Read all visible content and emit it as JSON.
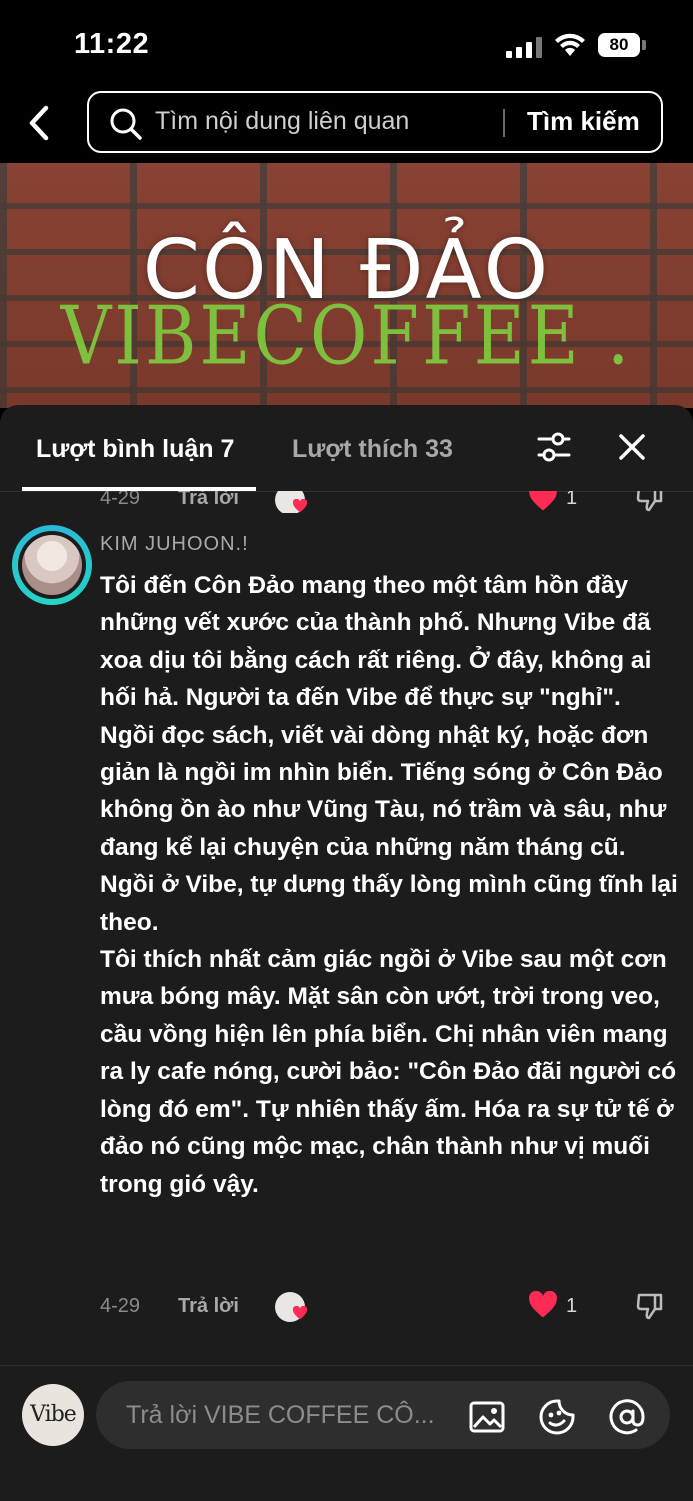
{
  "status_bar": {
    "time": "11:22",
    "battery": "80"
  },
  "search": {
    "placeholder": "Tìm nội dung liên quan",
    "button_label": "Tìm kiếm"
  },
  "banner": {
    "title": "CÔN ĐẢO",
    "subtitle": "VIBECOFFEE ."
  },
  "tabs": [
    {
      "label": "Lượt bình luận 7",
      "active": true
    },
    {
      "label": "Lượt thích 33",
      "active": false
    }
  ],
  "previous_comment": {
    "date": "4-29",
    "reply_label": "Trả lời",
    "likes": "1"
  },
  "comment": {
    "username": "KIM JUHOON.!",
    "paragraphs": [
      "Tôi đến Côn Đảo mang theo một tâm hồn đầy những vết xước của thành phố. Nhưng Vibe đã xoa dịu tôi bằng cách rất riêng. Ở đây, không ai hối hả. Người ta đến Vibe để thực sự \"nghỉ\". Ngồi đọc sách, viết vài dòng nhật ký, hoặc đơn giản là ngồi im nhìn biển. Tiếng sóng ở Côn Đảo không ồn ào như Vũng Tàu, nó trầm và sâu, như đang kể lại chuyện của những năm tháng cũ. Ngồi ở Vibe, tự dưng thấy lòng mình cũng tĩnh lại theo.",
      "Tôi thích nhất cảm giác ngồi ở Vibe sau một cơn mưa bóng mây. Mặt sân còn ướt, trời trong veo, cầu vồng hiện lên phía biển. Chị nhân viên mang ra ly cafe nóng, cười bảo: \"Côn Đảo đãi người có lòng đó em\". Tự nhiên thấy ấm. Hóa ra sự tử tế ở đảo nó cũng mộc mạc, chân thành như vị muối trong gió vậy."
    ],
    "date": "4-29",
    "reply_label": "Trả lời",
    "likes": "1"
  },
  "reply_bar": {
    "logo_text": "Vibe",
    "placeholder": "Trả lời VIBE COFFEE CÔ..."
  },
  "colors": {
    "accent_heart": "#fe2c55",
    "sheet_bg": "#1c1c1c",
    "avatar_ring": "#2bb8d8"
  }
}
